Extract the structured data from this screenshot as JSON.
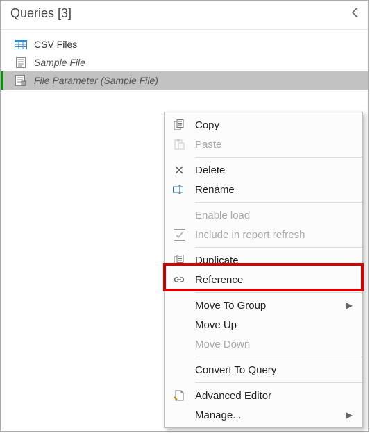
{
  "header": {
    "title": "Queries [3]"
  },
  "queries": [
    {
      "label": "CSV Files"
    },
    {
      "label": "Sample File"
    },
    {
      "label": "File Parameter (Sample File)"
    }
  ],
  "menu": {
    "copy": "Copy",
    "paste": "Paste",
    "delete": "Delete",
    "rename": "Rename",
    "enable_load": "Enable load",
    "include_refresh": "Include in report refresh",
    "duplicate": "Duplicate",
    "reference": "Reference",
    "move_to_group": "Move To Group",
    "move_up": "Move Up",
    "move_down": "Move Down",
    "convert_to_query": "Convert To Query",
    "advanced_editor": "Advanced Editor",
    "manage": "Manage..."
  }
}
